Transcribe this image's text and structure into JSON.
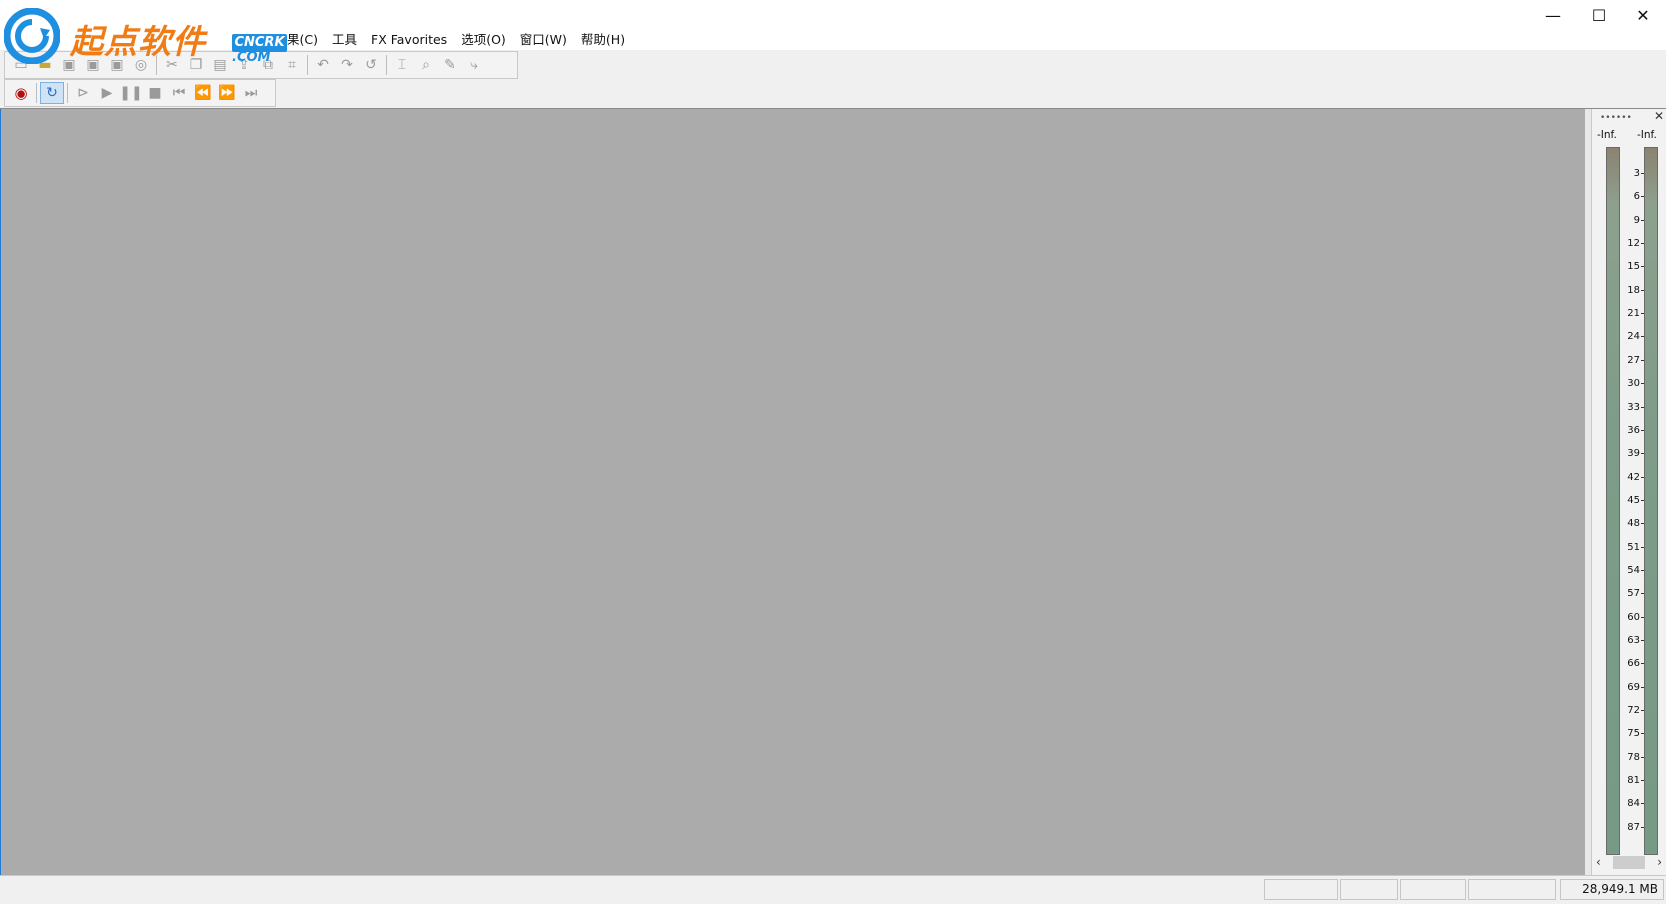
{
  "window": {
    "controls": {
      "minimize": "—",
      "maximize": "☐",
      "close": "✕"
    }
  },
  "logo": {
    "text": "起点软件",
    "badge": "CNCRK",
    "domain": ".COM",
    "brand_color": "#f07c16",
    "accent_color": "#1f8fe0"
  },
  "menu": {
    "items": [
      {
        "label": "果(C)"
      },
      {
        "label": "工具"
      },
      {
        "label": "FX Favorites"
      },
      {
        "label": "选项(O)"
      },
      {
        "label": "窗口(W)"
      },
      {
        "label": "帮助(H)"
      }
    ]
  },
  "toolbar_edit": {
    "icons": [
      "new-file-icon",
      "open-file-icon",
      "save-icon",
      "save-as-icon",
      "save-all-icon",
      "record-cd-icon",
      "cut-icon",
      "copy-icon",
      "paste-icon",
      "paste-new-icon",
      "mix-paste-icon",
      "trim-icon",
      "undo-icon",
      "redo-icon",
      "repeat-icon",
      "mark-icon",
      "zoom-icon",
      "pencil-icon",
      "envelope-icon"
    ]
  },
  "toolbar_transport": {
    "icons": [
      "record-icon",
      "loop-icon",
      "play-from-cursor-icon",
      "play-icon",
      "pause-icon",
      "stop-icon",
      "go-to-start-icon",
      "rewind-icon",
      "fast-forward-icon",
      "go-to-end-icon"
    ]
  },
  "meter": {
    "left_label": "-Inf.",
    "right_label": "-Inf.",
    "scale": [
      "3",
      "6",
      "9",
      "12",
      "15",
      "18",
      "21",
      "24",
      "27",
      "30",
      "33",
      "36",
      "39",
      "42",
      "45",
      "48",
      "51",
      "54",
      "57",
      "60",
      "63",
      "66",
      "69",
      "72",
      "75",
      "78",
      "81",
      "84",
      "87"
    ],
    "grip": "••••••",
    "close": "✕",
    "scroll_left": "‹",
    "scroll_right": "›"
  },
  "status": {
    "free_space": "28,949.1 MB"
  },
  "colors": {
    "workspace": "#ababab",
    "window_border": "#1e7bd6"
  }
}
